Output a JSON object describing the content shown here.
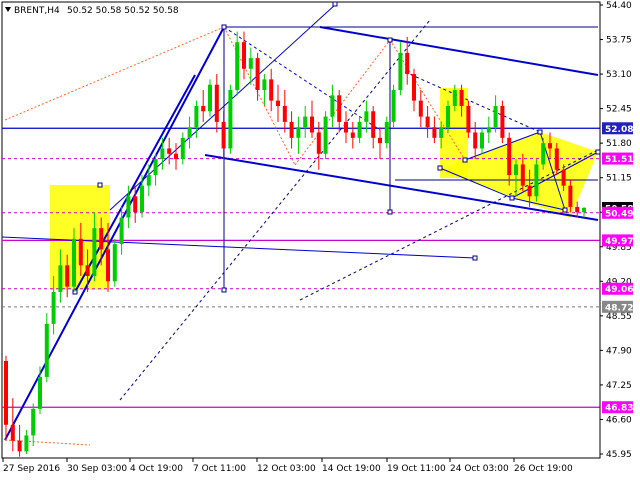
{
  "header": {
    "symbol": "BRENT,H4",
    "ohlc": "50.52 50.58 50.52 50.58"
  },
  "colors": {
    "bull": "#00cc00",
    "bear": "#ff0000",
    "channel": "#0000cc",
    "level": "#cc00cc",
    "badge_magenta": "#ff00ff",
    "badge_blue": "#2222bb",
    "zone": "#ffff00"
  },
  "chart_data": {
    "type": "candlestick",
    "y_axis_ticks": [
      "54.40",
      "53.75",
      "53.10",
      "52.45",
      "51.80",
      "51.15",
      "50.50",
      "49.85",
      "49.20",
      "48.55",
      "47.90",
      "47.25",
      "46.60",
      "45.95"
    ],
    "ylim": [
      45.95,
      54.4
    ],
    "x_axis_ticks": [
      "27 Sep 2016",
      "30 Sep 03:00",
      "4 Oct 19:00",
      "7 Oct 11:00",
      "12 Oct 03:00",
      "14 Oct 19:00",
      "19 Oct 11:00",
      "24 Oct 03:00",
      "26 Oct 19:00"
    ],
    "level_labels": [
      {
        "value": 52.08,
        "text": "52.08",
        "style": "blue"
      },
      {
        "value": 51.51,
        "text": "51.51",
        "style": "magenta"
      },
      {
        "value": 50.58,
        "text": "50.58",
        "style": "black"
      },
      {
        "value": 50.49,
        "text": "50.49",
        "style": "magenta"
      },
      {
        "value": 49.97,
        "text": "49.97",
        "style": "magenta"
      },
      {
        "value": 49.06,
        "text": "49.06",
        "style": "magenta"
      },
      {
        "value": 48.72,
        "text": "48.72",
        "style": "gray"
      },
      {
        "value": 46.83,
        "text": "46.83",
        "style": "magenta"
      }
    ],
    "candles": [
      [
        47.7,
        47.8,
        46.2,
        46.5
      ],
      [
        46.5,
        47.0,
        46.0,
        46.2
      ],
      [
        46.2,
        46.5,
        45.9,
        46.0
      ],
      [
        46.0,
        46.4,
        45.95,
        46.3
      ],
      [
        46.3,
        46.9,
        46.1,
        46.8
      ],
      [
        46.8,
        47.6,
        46.7,
        47.4
      ],
      [
        47.4,
        48.6,
        47.3,
        48.4
      ],
      [
        48.4,
        49.3,
        48.2,
        49.0
      ],
      [
        49.0,
        49.8,
        48.8,
        49.5
      ],
      [
        49.5,
        49.7,
        48.9,
        49.1
      ],
      [
        49.1,
        50.2,
        49.0,
        50.0
      ],
      [
        50.0,
        50.3,
        49.3,
        49.5
      ],
      [
        49.5,
        49.8,
        49.0,
        49.3
      ],
      [
        49.3,
        50.5,
        49.2,
        50.2
      ],
      [
        50.2,
        50.4,
        49.5,
        49.8
      ],
      [
        49.8,
        50.3,
        49.0,
        49.2
      ],
      [
        49.2,
        50.0,
        49.1,
        49.9
      ],
      [
        49.9,
        50.6,
        49.7,
        50.4
      ],
      [
        50.4,
        51.0,
        50.2,
        50.8
      ],
      [
        50.8,
        51.0,
        50.3,
        50.5
      ],
      [
        50.5,
        51.2,
        50.4,
        51.0
      ],
      [
        51.0,
        51.4,
        50.8,
        51.2
      ],
      [
        51.2,
        51.6,
        51.0,
        51.5
      ],
      [
        51.5,
        51.9,
        51.3,
        51.7
      ],
      [
        51.7,
        51.9,
        51.4,
        51.6
      ],
      [
        51.6,
        51.8,
        51.3,
        51.5
      ],
      [
        51.5,
        52.0,
        51.4,
        51.9
      ],
      [
        51.9,
        52.3,
        51.7,
        52.1
      ],
      [
        52.1,
        52.6,
        51.9,
        52.5
      ],
      [
        52.5,
        52.8,
        52.2,
        52.4
      ],
      [
        52.4,
        53.0,
        52.3,
        52.9
      ],
      [
        52.9,
        53.1,
        52.0,
        52.2
      ],
      [
        52.2,
        52.4,
        51.5,
        51.7
      ],
      [
        51.7,
        52.9,
        51.6,
        52.8
      ],
      [
        52.8,
        53.9,
        52.7,
        53.7
      ],
      [
        53.7,
        53.9,
        53.0,
        53.2
      ],
      [
        53.2,
        53.6,
        52.9,
        53.4
      ],
      [
        53.4,
        53.5,
        52.6,
        52.8
      ],
      [
        52.8,
        53.1,
        52.5,
        53.0
      ],
      [
        53.0,
        53.2,
        52.4,
        52.6
      ],
      [
        52.6,
        52.9,
        52.2,
        52.5
      ],
      [
        52.5,
        52.8,
        52.0,
        52.2
      ],
      [
        52.2,
        52.4,
        51.7,
        51.9
      ],
      [
        51.9,
        52.3,
        51.6,
        52.1
      ],
      [
        52.1,
        52.5,
        51.9,
        52.3
      ],
      [
        52.3,
        52.6,
        51.9,
        52.0
      ],
      [
        52.0,
        52.2,
        51.3,
        51.6
      ],
      [
        51.6,
        52.4,
        51.5,
        52.3
      ],
      [
        52.3,
        52.9,
        52.1,
        52.7
      ],
      [
        52.7,
        52.8,
        52.0,
        52.2
      ],
      [
        52.2,
        52.4,
        51.8,
        52.0
      ],
      [
        52.0,
        52.2,
        51.7,
        51.9
      ],
      [
        51.9,
        52.3,
        51.8,
        52.2
      ],
      [
        52.2,
        52.6,
        52.0,
        52.4
      ],
      [
        52.4,
        52.5,
        51.7,
        51.9
      ],
      [
        51.9,
        52.1,
        51.5,
        51.8
      ],
      [
        51.8,
        52.3,
        51.7,
        52.2
      ],
      [
        52.2,
        52.9,
        52.1,
        52.8
      ],
      [
        52.8,
        53.7,
        52.7,
        53.5
      ],
      [
        53.5,
        53.8,
        52.9,
        53.1
      ],
      [
        53.1,
        53.2,
        52.4,
        52.6
      ],
      [
        52.6,
        52.8,
        52.1,
        52.3
      ],
      [
        52.3,
        52.5,
        51.9,
        52.1
      ],
      [
        52.1,
        52.3,
        51.8,
        51.9
      ],
      [
        51.9,
        52.2,
        51.7,
        52.1
      ],
      [
        52.1,
        52.6,
        52.0,
        52.5
      ],
      [
        52.5,
        52.9,
        52.4,
        52.8
      ],
      [
        52.8,
        52.9,
        52.3,
        52.5
      ],
      [
        52.5,
        52.6,
        51.9,
        52.0
      ],
      [
        52.0,
        52.2,
        51.5,
        51.7
      ],
      [
        51.7,
        52.1,
        51.6,
        52.0
      ],
      [
        52.0,
        52.3,
        51.8,
        52.1
      ],
      [
        52.1,
        52.7,
        52.0,
        52.5
      ],
      [
        52.5,
        52.6,
        51.8,
        51.9
      ],
      [
        51.9,
        52.0,
        51.0,
        51.2
      ],
      [
        51.2,
        51.5,
        50.8,
        51.4
      ],
      [
        51.4,
        51.6,
        50.9,
        51.0
      ],
      [
        51.0,
        51.3,
        50.6,
        50.8
      ],
      [
        50.8,
        51.5,
        50.7,
        51.4
      ],
      [
        51.4,
        51.9,
        51.3,
        51.8
      ],
      [
        51.8,
        52.0,
        51.5,
        51.7
      ],
      [
        51.7,
        51.8,
        51.2,
        51.3
      ],
      [
        51.3,
        51.4,
        50.9,
        51.0
      ],
      [
        51.0,
        51.1,
        50.5,
        50.6
      ],
      [
        50.6,
        50.7,
        50.4,
        50.5
      ],
      [
        50.5,
        50.6,
        50.4,
        50.58
      ]
    ]
  }
}
